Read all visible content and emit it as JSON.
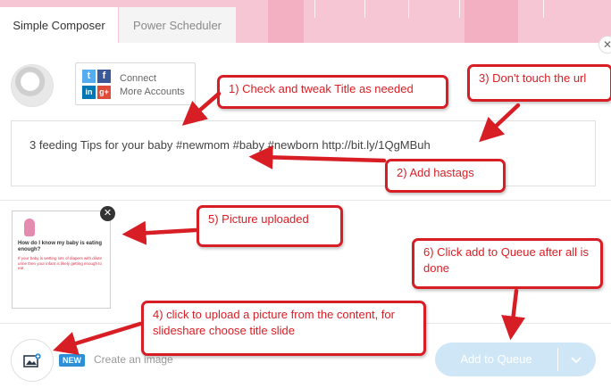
{
  "tabs": [
    {
      "label": "Simple Composer",
      "active": true
    },
    {
      "label": "Power Scheduler",
      "active": false
    }
  ],
  "close_panel_icon": "close-icon",
  "connect": {
    "line1": "Connect",
    "line2": "More Accounts",
    "icons": [
      "twitter-icon",
      "facebook-icon",
      "linkedin-icon",
      "google-plus-icon"
    ]
  },
  "composer": {
    "text": "3 feeding Tips for your baby #newmom #baby #newborn http://bit.ly/1QgMBuh"
  },
  "attachment": {
    "heading": "How do I know my baby is eating enough?",
    "body": "If your baby is wetting lots of diapers with dilute urine then your infant is likely getting enough to eat",
    "close_icon": "close-icon"
  },
  "footer": {
    "badge": "NEW",
    "create_image": "Create an image",
    "queue_button": "Add to Queue"
  },
  "callouts": {
    "c1": "1) Check and tweak Title as needed",
    "c2": "2) Add hastags",
    "c3": "3) Don't touch the url",
    "c4": "4) click to upload a picture from the content, for slideshare choose title slide",
    "c5": "5) Picture uploaded",
    "c6": "6) Click add to Queue after all is done"
  },
  "colors": {
    "accent_red": "#d81e25",
    "queue_button": "#cfe6f6",
    "header_pink": "#f7c6d4",
    "badge_blue": "#2d8fd8"
  }
}
